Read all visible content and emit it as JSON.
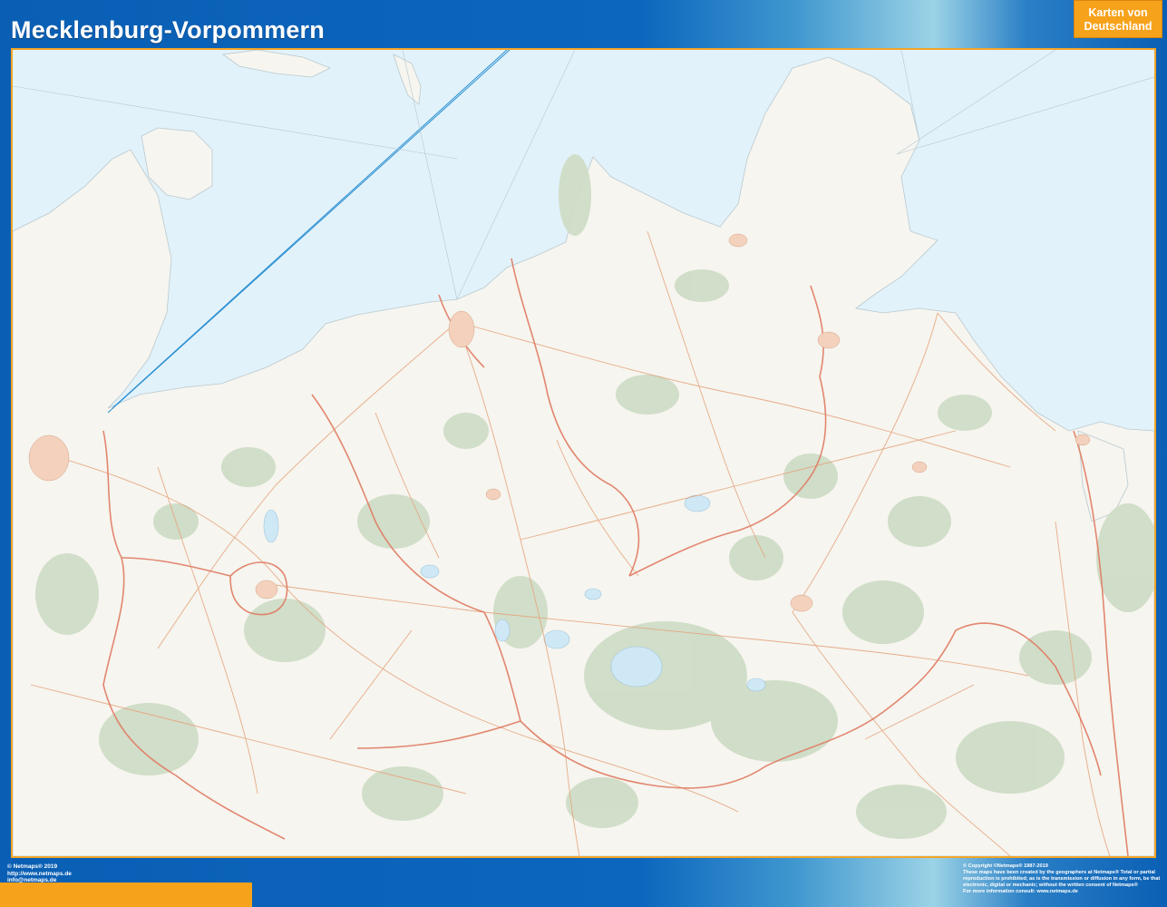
{
  "header": {
    "title": "Mecklenburg-Vorpommern",
    "badge_line1": "Karten von",
    "badge_line2": "Deutschland"
  },
  "footer_left": {
    "line1": "© Netmaps® 2019",
    "line2": "http://www.netmaps.de",
    "line3": "info@netmaps.de"
  },
  "footer_right": {
    "line1": "© Copyright ©Netmaps® 1987-2019",
    "line2": "These maps have been created by the geographers at Netmaps® Total or partial",
    "line3": "reproduction is prohibited; as is the transmission or diffusion in any form, be that",
    "line4": "electronic, digital or mechanic; without the written consent of Netmaps®",
    "line5": "For more information consult: www.netmaps.de"
  },
  "colors": {
    "frame_blue": "#0a5fb4",
    "accent_orange": "#f7a21b",
    "sea": "#e2f2fb",
    "land": "#f6f5ef",
    "forest": "#cfdcc6",
    "border_red": "#e07a62",
    "road": "#e6a37c",
    "ferry_line": "#2a8fd1"
  }
}
